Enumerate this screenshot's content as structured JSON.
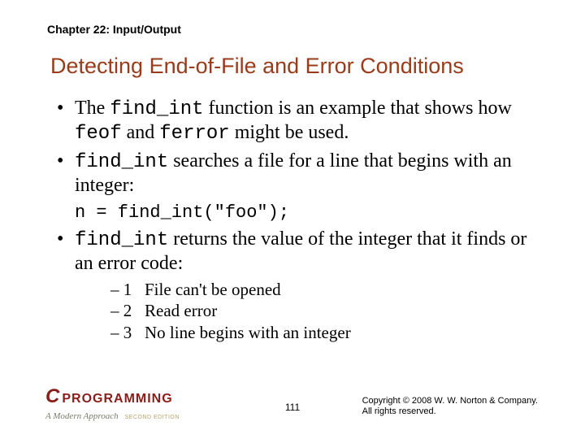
{
  "chapter": "Chapter 22: Input/Output",
  "title": "Detecting End-of-File and Error Conditions",
  "bullets": {
    "b1a": "The ",
    "b1b": "find_int",
    "b1c": " function is an example that shows how ",
    "b1d": "feof",
    "b1e": " and ",
    "b1f": "ferror",
    "b1g": " might be used.",
    "b2a": "find_int",
    "b2b": " searches a file for a line that begins with an integer:",
    "code": "n = find_int(\"foo\");",
    "b3a": "find_int",
    "b3b": " returns the value of the integer that it finds or an error code:"
  },
  "errors": [
    {
      "code": "– 1",
      "desc": "File can't be opened"
    },
    {
      "code": "– 2",
      "desc": "Read error"
    },
    {
      "code": "– 3",
      "desc": "No line begins with an integer"
    }
  ],
  "footer": {
    "logo_c": "C",
    "logo_text": "PROGRAMMING",
    "logo_sub": "A Modern Approach",
    "edition": "SECOND EDITION",
    "page": "111",
    "copy1": "Copyright © 2008 W. W. Norton & Company.",
    "copy2": "All rights reserved."
  }
}
